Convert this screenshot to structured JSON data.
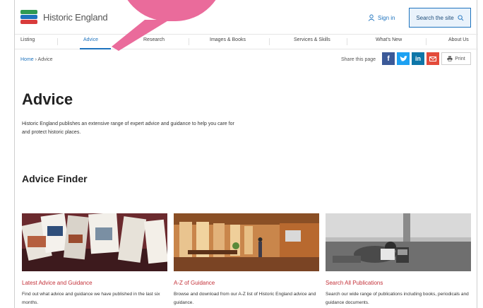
{
  "header": {
    "logo_text": "Historic England",
    "signin_label": "Sign in",
    "search_label": "Search the site"
  },
  "nav": {
    "items": [
      "Listing",
      "Advice",
      "Research",
      "Images & Books",
      "Services & Skills",
      "What's New",
      "About Us"
    ],
    "active": "Advice"
  },
  "breadcrumb": {
    "home": "Home",
    "current": "Advice"
  },
  "share": {
    "label": "Share this page",
    "print_label": "Print"
  },
  "page": {
    "title": "Advice",
    "intro": "Historic England publishes an extensive range of expert advice and guidance to help you care for and protect historic places.",
    "finder_title": "Advice Finder"
  },
  "cards": [
    {
      "title": "Latest Advice and Guidance",
      "desc": "Find out what advice and guidance we have published in the last six months."
    },
    {
      "title": "A-Z of Guidance",
      "desc": "Browse and download from our A-Z list of Historic England advice and guidance."
    },
    {
      "title": "Search All Publications",
      "desc": "Search our wide range of publications including books, periodicals and guidance documents."
    }
  ],
  "colors": {
    "brand_blue": "#1e73be",
    "link_red": "#c4323a",
    "overlay_pink": "#ea6b9b",
    "facebook": "#3b5998",
    "twitter": "#1da1f2",
    "linkedin": "#0e76a8",
    "email": "#e34b3b"
  }
}
